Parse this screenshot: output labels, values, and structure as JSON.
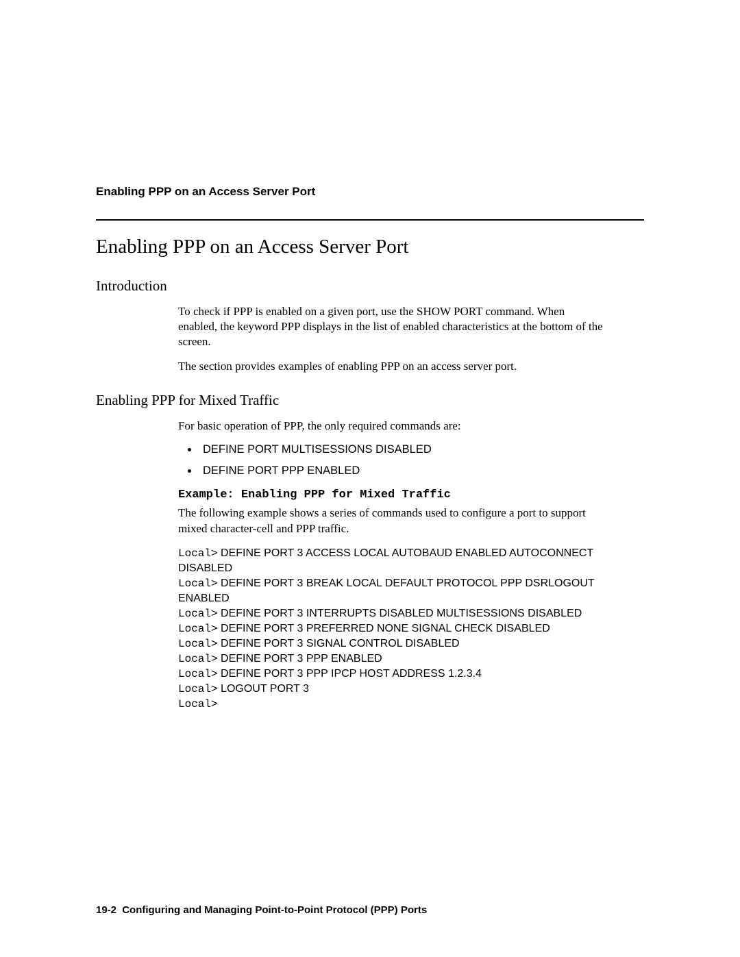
{
  "running_head": "Enabling PPP on an Access Server Port",
  "title": "Enabling PPP on an Access Server Port",
  "intro": {
    "heading": "Introduction",
    "p1": "To check if PPP is enabled on a given port, use the SHOW PORT command. When enabled, the keyword PPP displays in the list of enabled characteristics at the bottom of the screen.",
    "p2": "The section provides examples of enabling PPP on an access server port."
  },
  "mixed": {
    "heading": "Enabling PPP for Mixed Traffic",
    "p1": "For basic operation of PPP, the only required commands are:",
    "bullets": [
      "DEFINE PORT MULTISESSIONS DISABLED",
      "DEFINE PORT PPP ENABLED"
    ],
    "example_head": "Example: Enabling PPP for Mixed Traffic",
    "example_p": "The following example shows a series of commands used to configure a port to support mixed character-cell and PPP traffic.",
    "terminal": [
      {
        "prompt": "Local>",
        "cmd": " DEFINE PORT 3 ACCESS LOCAL AUTOBAUD ENABLED AUTOCONNECT DISABLED"
      },
      {
        "prompt": "Local>",
        "cmd": " DEFINE PORT 3 BREAK LOCAL DEFAULT PROTOCOL PPP DSRLOGOUT ENABLED"
      },
      {
        "prompt": "Local>",
        "cmd": " DEFINE PORT 3 INTERRUPTS DISABLED MULTISESSIONS DISABLED"
      },
      {
        "prompt": "Local>",
        "cmd": " DEFINE PORT 3 PREFERRED NONE SIGNAL CHECK DISABLED"
      },
      {
        "prompt": "Local>",
        "cmd": " DEFINE PORT 3 SIGNAL CONTROL DISABLED"
      },
      {
        "prompt": "Local>",
        "cmd": " DEFINE PORT 3 PPP ENABLED"
      },
      {
        "prompt": "Local>",
        "cmd": " DEFINE PORT 3 PPP IPCP HOST ADDRESS 1.2.3.4"
      },
      {
        "prompt": "Local>",
        "cmd": " LOGOUT PORT 3"
      },
      {
        "prompt": "Local>",
        "cmd": ""
      }
    ]
  },
  "footer": {
    "page_no": "19-2",
    "chapter": "Configuring and Managing Point-to-Point Protocol (PPP) Ports"
  }
}
